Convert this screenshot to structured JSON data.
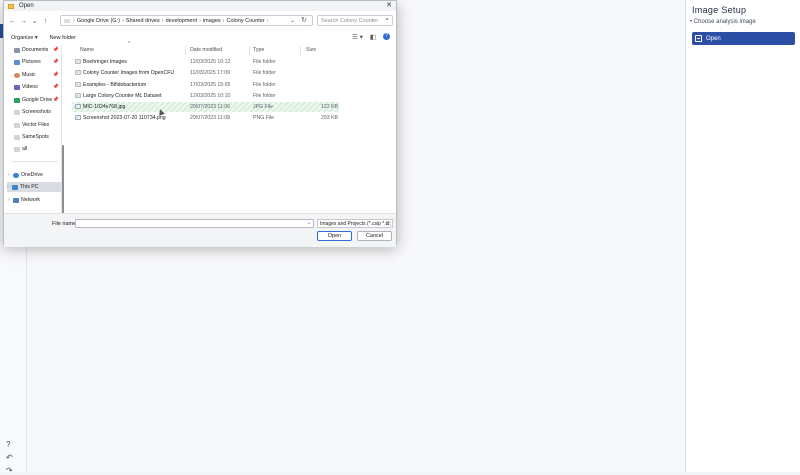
{
  "app": {
    "right_panel": {
      "title": "Image Setup",
      "bullet": "• Choose analysis image",
      "open_button": "Open"
    },
    "left_icons": [
      "help-icon",
      "undo-icon",
      "redo-icon"
    ]
  },
  "dialog": {
    "title": "Open",
    "nav": {
      "back": "←",
      "forward": "→",
      "recent": "⌄",
      "up": "↑"
    },
    "breadcrumbs": [
      "Google Drive (G:)",
      "Shared drives",
      "development",
      "images",
      "Colony Counter"
    ],
    "search_placeholder": "Search Colony Counter",
    "toolbar": {
      "organize": "Organize ▾",
      "new_folder": "New folder"
    },
    "sidebar": [
      {
        "label": "Documents",
        "pinned": true,
        "icon": "documents-icon"
      },
      {
        "label": "Pictures",
        "pinned": true,
        "icon": "pictures-icon"
      },
      {
        "label": "Music",
        "pinned": true,
        "icon": "music-icon"
      },
      {
        "label": "Videos",
        "pinned": true,
        "icon": "videos-icon"
      },
      {
        "label": "Google Drive",
        "pinned": true,
        "icon": "google-drive-icon"
      },
      {
        "label": "Screenshots",
        "pinned": false,
        "icon": "folder-icon"
      },
      {
        "label": "Vector Files",
        "pinned": false,
        "icon": "folder-icon"
      },
      {
        "label": "SameSpots",
        "pinned": false,
        "icon": "folder-icon"
      },
      {
        "label": "all",
        "pinned": false,
        "icon": "folder-icon"
      }
    ],
    "locations": [
      {
        "label": "OneDrive",
        "icon": "onedrive-icon"
      },
      {
        "label": "This PC",
        "icon": "computer-icon"
      },
      {
        "label": "Network",
        "icon": "network-icon"
      }
    ],
    "columns": {
      "name": "Name",
      "date": "Date modified",
      "type": "Type",
      "size": "Size"
    },
    "files": [
      {
        "name": "Boehringer Images",
        "date": "12/03/2025 10:12",
        "type": "File folder",
        "size": "",
        "kind": "folder"
      },
      {
        "name": "Colony Counter Images from OpenCFU",
        "date": "11/03/2025 17:09",
        "type": "File folder",
        "size": "",
        "kind": "folder"
      },
      {
        "name": "Examples - Bifidobacterium",
        "date": "17/03/2025 15:05",
        "type": "File folder",
        "size": "",
        "kind": "folder"
      },
      {
        "name": "Large Colony Counter ML Dataset",
        "date": "12/03/2025 10:10",
        "type": "File folder",
        "size": "",
        "kind": "folder"
      },
      {
        "name": "MIC-1024x768.jpg",
        "date": "20/07/2023 11:06",
        "type": "JPG File",
        "size": "122 KB",
        "kind": "image"
      },
      {
        "name": "Screenshot 2023-07-20 110734.png",
        "date": "20/07/2023 11:08",
        "type": "PNG File",
        "size": "293 KB",
        "kind": "image"
      }
    ],
    "selected_file_index": 4,
    "filename_label": "File name:",
    "filename_value": "",
    "filetype_value": "Images and Projects (*.csip *.tif;",
    "open_button": "Open",
    "cancel_button": "Cancel"
  }
}
